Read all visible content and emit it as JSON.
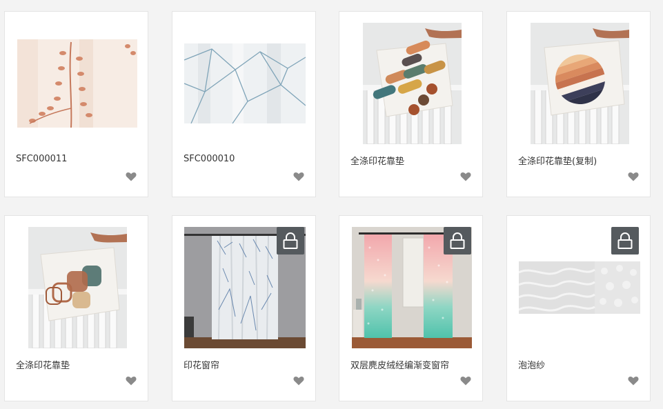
{
  "products": [
    {
      "title": "SFC000011",
      "thumb": "branch-print-fabric",
      "locked": false
    },
    {
      "title": "SFC000010",
      "thumb": "geometric-line-sheer-fabric",
      "locked": false
    },
    {
      "title": "全涤印花靠垫",
      "thumb": "cushion-pill-pattern",
      "locked": false
    },
    {
      "title": "全涤印花靠垫(复制)",
      "thumb": "cushion-striped-circle",
      "locked": false
    },
    {
      "title": "全涤印花靠垫",
      "thumb": "cushion-rounded-squares",
      "locked": false
    },
    {
      "title": "印花窗帘",
      "thumb": "printed-sheer-curtain",
      "locked": true
    },
    {
      "title": "双层麂皮绒经编渐变窗帘",
      "thumb": "gradient-curtain",
      "locked": true
    },
    {
      "title": "泡泡纱",
      "thumb": "seersucker-fabric",
      "locked": true
    }
  ],
  "icons": {
    "favorite": "heart-icon",
    "locked": "lock-icon"
  },
  "colors": {
    "heart": "#8a8a8a",
    "lock_badge": "#555a5e",
    "card_bg": "#ffffff",
    "page_bg": "#f3f3f3"
  }
}
